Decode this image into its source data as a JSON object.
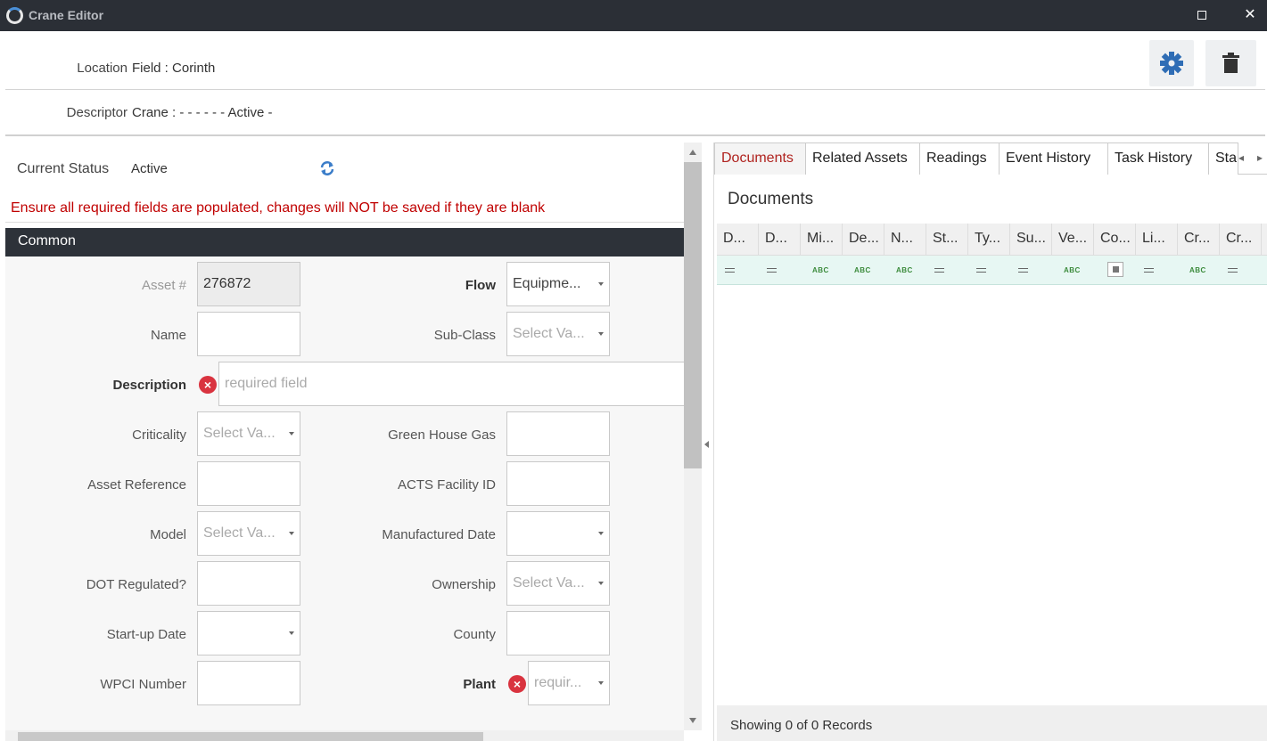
{
  "window": {
    "title": "Crane Editor",
    "maximize_icon": "maximize-icon",
    "close_label": "✕"
  },
  "header": {
    "location_label": "Location",
    "location_value": "Field : Corinth",
    "descriptor_label": "Descriptor",
    "descriptor_value": "Crane :  -  -  -  -  -  - Active -"
  },
  "toolbar": {
    "settings_icon": "gear-icon",
    "delete_icon": "trash-icon"
  },
  "status": {
    "label": "Current Status",
    "value": "Active"
  },
  "warning": "Ensure all required fields are populated, changes will NOT be saved if they are blank",
  "section": {
    "title": "Common"
  },
  "form": {
    "asset_label": "Asset #",
    "asset_value": "276872",
    "flow_label": "Flow",
    "flow_value": "Equipme...",
    "name_label": "Name",
    "subclass_label": "Sub-Class",
    "subclass_value": "Select Va...",
    "description_label": "Description",
    "description_placeholder": "required field",
    "criticality_label": "Criticality",
    "criticality_value": "Select Va...",
    "ghg_label": "Green House Gas",
    "assetref_label": "Asset Reference",
    "acts_label": "ACTS Facility ID",
    "model_label": "Model",
    "model_value": "Select Va...",
    "mfgdate_label": "Manufactured Date",
    "dot_label": "DOT Regulated?",
    "ownership_label": "Ownership",
    "ownership_value": "Select Va...",
    "startup_label": "Start-up Date",
    "county_label": "County",
    "wpci_label": "WPCI Number",
    "plant_label": "Plant",
    "plant_placeholder": "requir..."
  },
  "tabs": [
    "Documents",
    "Related Assets",
    "Readings",
    "Event History",
    "Task History",
    "Sta"
  ],
  "documents": {
    "title": "Documents",
    "columns": [
      "D...",
      "D...",
      "Mi...",
      "De...",
      "N...",
      "St...",
      "Ty...",
      "Su...",
      "Ve...",
      "Co...",
      "Li...",
      "Cr...",
      "Cr..."
    ],
    "filters": [
      "eq",
      "eq",
      "abc",
      "abc",
      "abc",
      "eq",
      "eq",
      "eq",
      "abc",
      "chk",
      "eq",
      "abc",
      "eq"
    ],
    "abc_text": "ABC",
    "footer": "Showing 0 of 0 Records"
  }
}
